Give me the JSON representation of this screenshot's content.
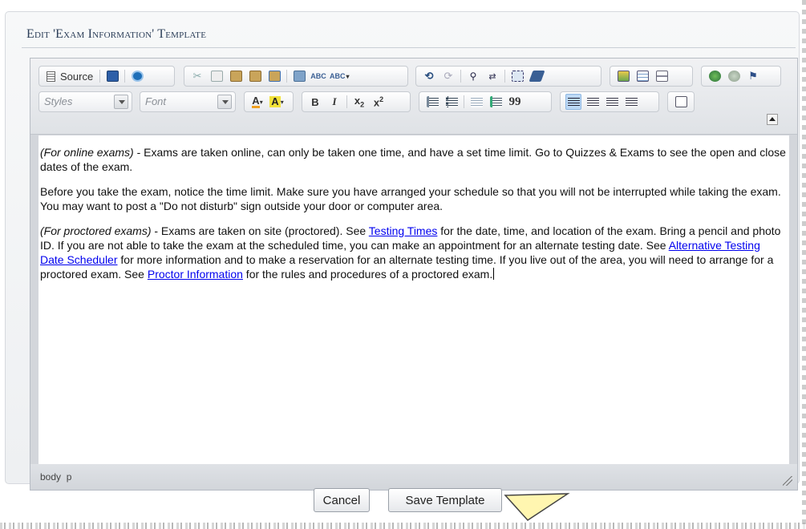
{
  "panel": {
    "title": "Edit 'Exam Information' Template"
  },
  "toolbar": {
    "row1": {
      "source_label": "Source",
      "spellcheck_label": "ABC",
      "scayt_label": "ABC"
    },
    "row2": {
      "styles_label": "Styles",
      "font_label": "Font",
      "bold_label": "B",
      "italic_label": "I",
      "subscript_label": "x",
      "subscript_sub": "2",
      "superscript_label": "x",
      "superscript_sup": "2",
      "blockquote_label": "99"
    }
  },
  "content": {
    "paragraphs": [
      {
        "intro": "(For online exams)",
        "text": " - Exams are taken online, can only be taken one time, and have a set time limit. Go to Quizzes & Exams to see the open and close dates of the exam."
      },
      {
        "text": "Before you take the exam, notice the time limit. Make sure you have arranged your schedule so that you will not be interrupted while taking the exam. You may want to post a \"Do not disturb\" sign outside your door or computer area."
      },
      {
        "intro": "(For proctored exams)",
        "text_a": " - Exams are taken on site (proctored). See ",
        "link_a": "Testing Times",
        "text_b": " for the date, time, and location of the exam. Bring a pencil and photo ID. If you are not able to take the exam at the scheduled time, you can make an appointment for an alternate testing date. See ",
        "link_b": "Alternative Testing Date Scheduler",
        "text_c": " for more information and to make a reservation for an alternate testing time. If you live out of the area, you will need to arrange for a proctored exam. See ",
        "link_c": "Proctor Information",
        "text_d": " for the rules and procedures of a proctored exam."
      }
    ]
  },
  "statusbar": {
    "path": "body  p"
  },
  "actions": {
    "cancel_label": "Cancel",
    "save_label": "Save Template"
  },
  "colors": {
    "link": "#0000ee",
    "title": "#2b3e58",
    "active_button": "#bcd8f5"
  }
}
